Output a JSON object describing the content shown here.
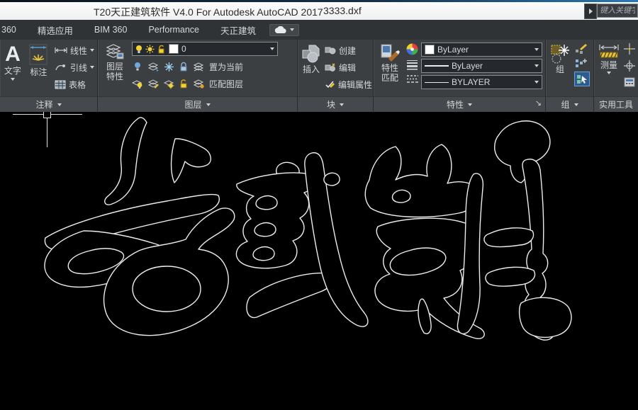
{
  "window": {
    "title": "T20天正建筑软件 V4.0 For Autodesk AutoCAD 2017",
    "document_name": "3333.dxf"
  },
  "search": {
    "placeholder": "键入关键字"
  },
  "menubar": {
    "items": [
      "360",
      "精选应用",
      "BIM 360",
      "Performance",
      "天正建筑"
    ]
  },
  "ribbon": {
    "annotation": {
      "big_letter": "A",
      "text_label": "文字",
      "dim_label": "标注",
      "linear_label": "线性",
      "leader_label": "引线",
      "table_label": "表格",
      "footer": "注释"
    },
    "layers": {
      "props_line1": "图层",
      "props_line2": "特性",
      "combo_value": "0",
      "set_current_label": "置为当前",
      "match_label": "匹配图层",
      "footer": "图层"
    },
    "block": {
      "insert_label": "插入",
      "create_label": "创建",
      "edit_label": "编辑",
      "edit_attr_label": "编辑属性",
      "footer": "块"
    },
    "properties": {
      "match_line1": "特性",
      "match_line2": "匹配",
      "color_value": "ByLayer",
      "lineweight_value": "ByLayer",
      "linetype_value": "BYLAYER",
      "footer": "特性"
    },
    "group": {
      "label": "组",
      "footer": "组"
    },
    "utilities": {
      "measure_label": "测量",
      "footer": "实用工具"
    }
  },
  "canvas": {
    "calligraphy_text": "龙城岁月",
    "background": "#000000",
    "line_color": "#ececec"
  },
  "colors": {
    "titlebar_bg": "#f5f6f7",
    "menubar_bg": "#2f3336",
    "ribbon_bg": "#3b3f42",
    "accent_yellow": "#e8c23a",
    "accent_blue": "#5b9bd5",
    "highlight_button_bg": "#2f5a8f"
  }
}
